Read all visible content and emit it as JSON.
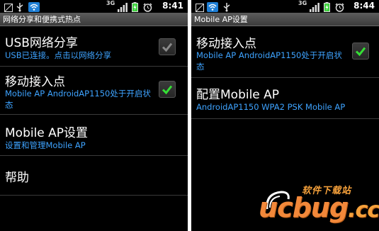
{
  "left_screen": {
    "status_bar": {
      "time": "8:41",
      "network_label": "3G"
    },
    "title": "网络分享和便携式热点",
    "items": [
      {
        "title": "USB网络分享",
        "summary": "USB已连接。点击以网络分享",
        "checked": false
      },
      {
        "title": "移动接入点",
        "summary": "Mobile AP AndroidAP1150处于开启状态",
        "checked": true
      },
      {
        "title": "Mobile AP设置",
        "summary": "设置和管理Mobile AP"
      },
      {
        "title": "帮助"
      }
    ]
  },
  "right_screen": {
    "status_bar": {
      "time": "8:44",
      "network_label": "3G"
    },
    "title": "Mobile AP设置",
    "items": [
      {
        "title": "移动接入点",
        "summary": "Mobile AP AndroidAP1150处于开启状态",
        "checked": true
      },
      {
        "title": "配置Mobile AP",
        "summary": "AndroidAP1150 WPA2 PSK Mobile AP"
      }
    ]
  },
  "watermark": {
    "tagline": "软件下载站",
    "logo": "ucbug",
    "logo_suffix": ".cc"
  },
  "colors": {
    "summary_text": "#3ea3ff",
    "check_green": "#35e035",
    "check_grey": "#8a8a8a",
    "battery_green": "#3fd33f",
    "watermark_orange": "#f2883a"
  }
}
